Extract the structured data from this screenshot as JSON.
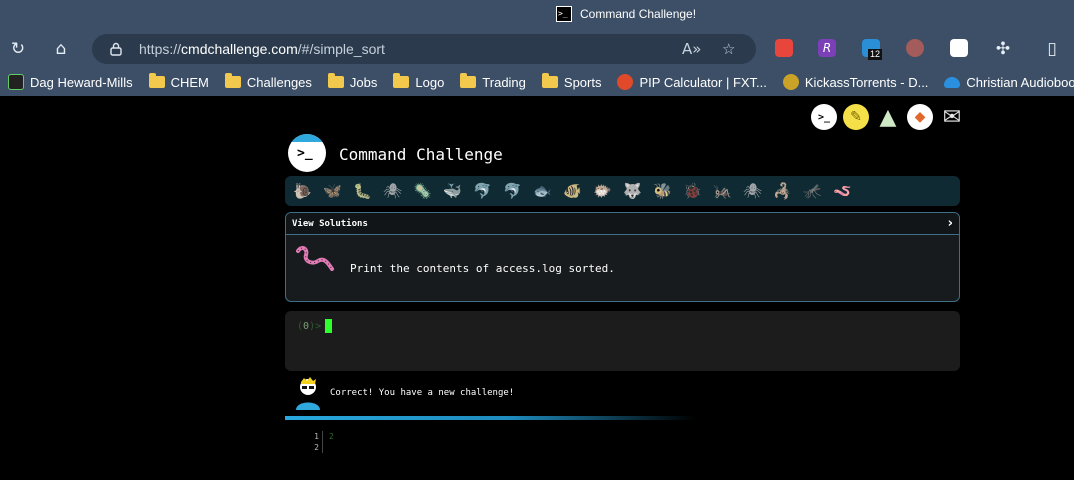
{
  "browser": {
    "tab_title": "Command Challenge!",
    "url_scheme": "https://",
    "url_host": "cmdchallenge.com",
    "url_path": "/#/simple_sort",
    "extension_badge": "12",
    "bookmarks": [
      {
        "label": "Dag Heward-Mills",
        "icon": "wifi-icon"
      },
      {
        "label": "CHEM",
        "icon": "folder-icon"
      },
      {
        "label": "Challenges",
        "icon": "folder-icon"
      },
      {
        "label": "Jobs",
        "icon": "folder-icon"
      },
      {
        "label": "Logo",
        "icon": "folder-icon"
      },
      {
        "label": "Trading",
        "icon": "folder-icon"
      },
      {
        "label": "Sports",
        "icon": "folder-icon"
      },
      {
        "label": "PIP Calculator | FXT...",
        "icon": "pip-icon"
      },
      {
        "label": "KickassTorrents - D...",
        "icon": "kat-icon"
      },
      {
        "label": "Christian Audioboo...",
        "icon": "cloud-icon"
      }
    ]
  },
  "page": {
    "site_title": "Command Challenge",
    "logo_glyph": ">_",
    "corner_icons": [
      "terminal-icon",
      "lightbulb-icon",
      "tree-icon",
      "gitlab-icon",
      "mail-icon"
    ],
    "critters": [
      "🐌",
      "🦋",
      "🐛",
      "🕷",
      "🦠",
      "🐳",
      "🐬",
      "🐬",
      "🐟",
      "🐠",
      "🐡",
      "🐺",
      "🐝",
      "🐞",
      "🦗",
      "🕷",
      "🦂",
      "🦟",
      "🪱"
    ],
    "critters_active_index": 18,
    "panel": {
      "header": "View Solutions",
      "chevron": "›",
      "task": "Print the contents of access.log sorted."
    },
    "terminal": {
      "prompt_open": "(",
      "prompt_num": "0",
      "prompt_close": ")>"
    },
    "result_message": "Correct! You have a new challenge!",
    "editor": {
      "lines": [
        "1",
        "2"
      ],
      "code": "2"
    }
  }
}
